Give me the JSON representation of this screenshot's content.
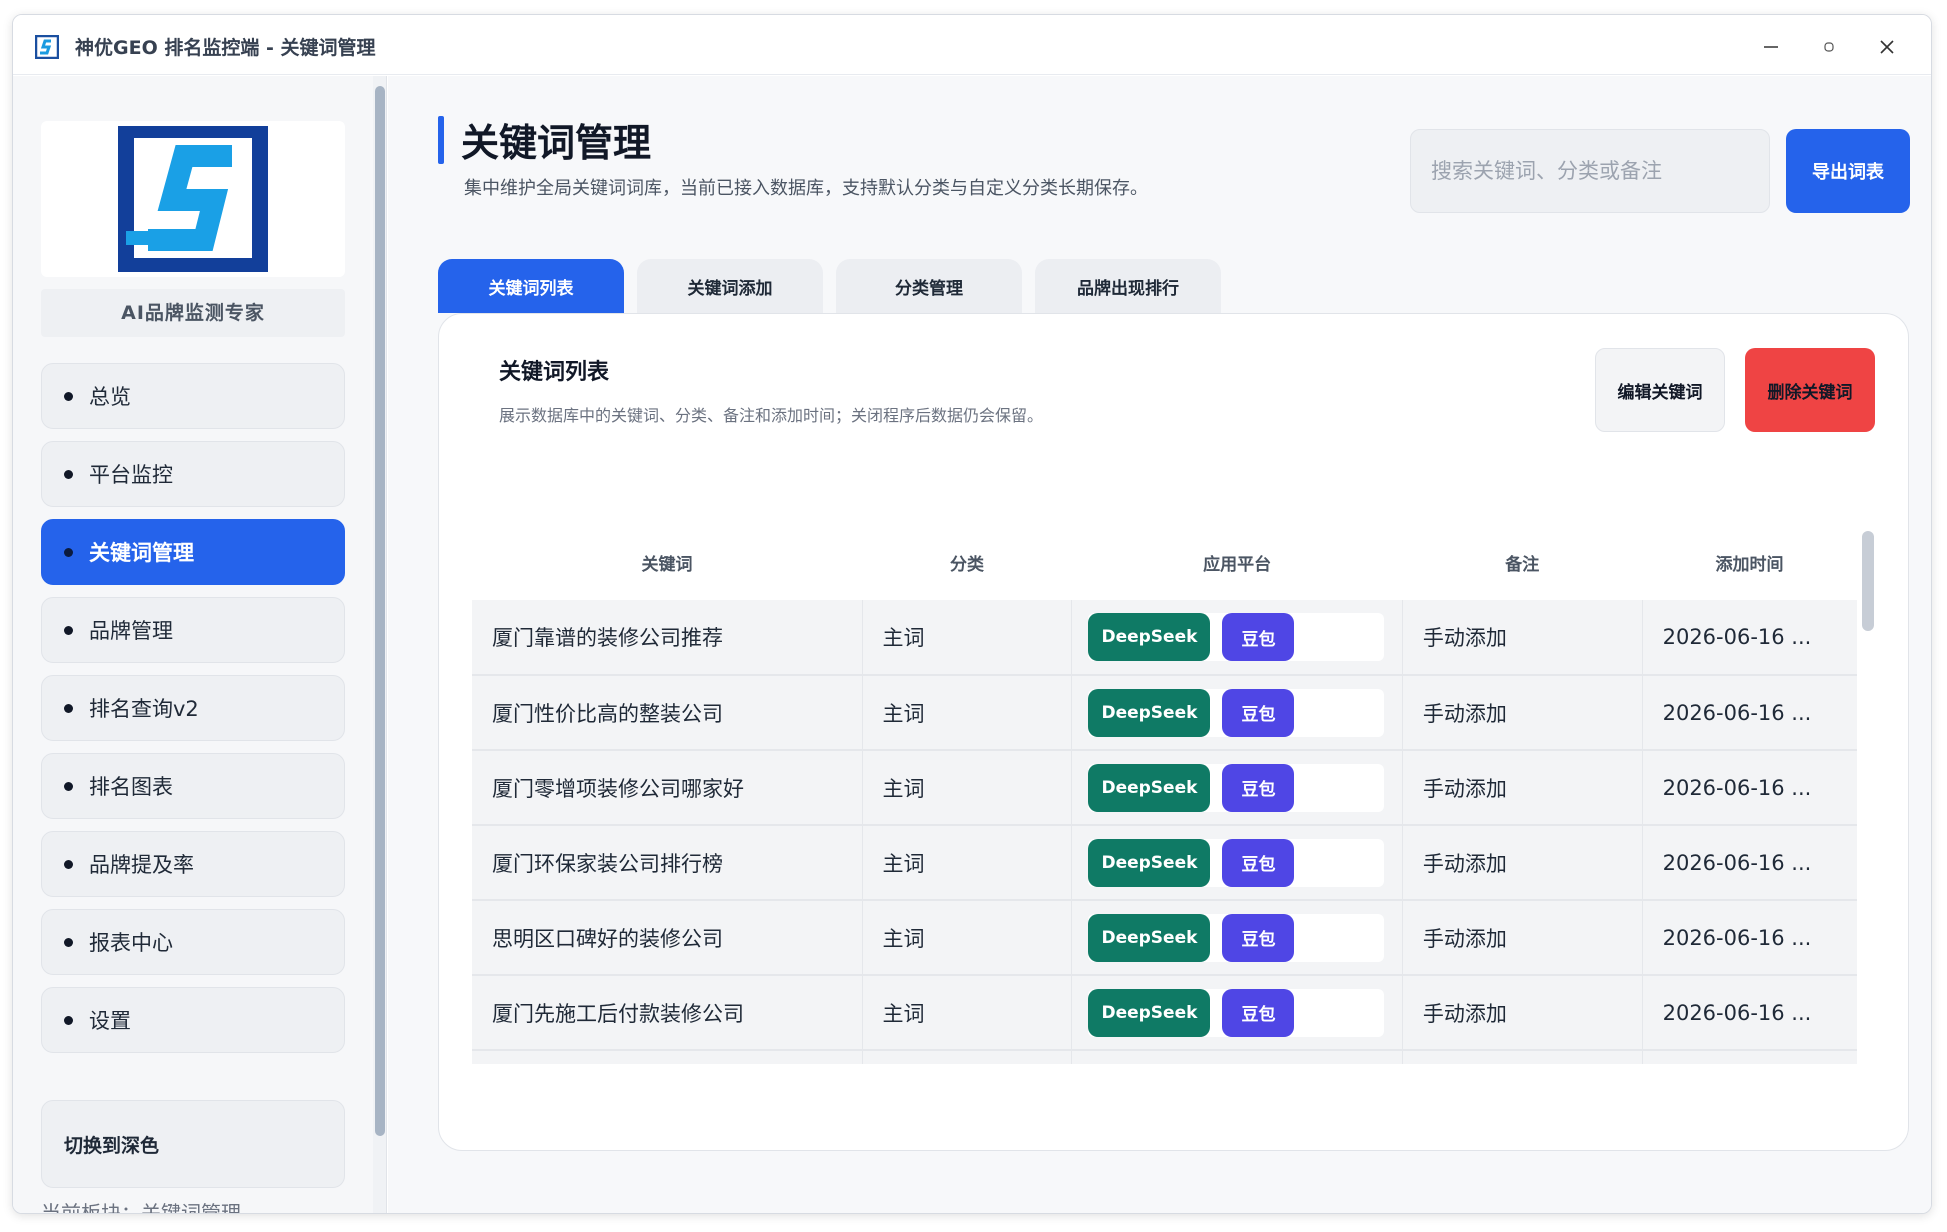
{
  "window": {
    "title": "神优GEO 排名监控端 - 关键词管理"
  },
  "sidebar": {
    "brand_caption": "AI品牌监测专家",
    "items": [
      {
        "label": "总览",
        "active": false
      },
      {
        "label": "平台监控",
        "active": false
      },
      {
        "label": "关键词管理",
        "active": true
      },
      {
        "label": "品牌管理",
        "active": false
      },
      {
        "label": "排名查询v2",
        "active": false
      },
      {
        "label": "排名图表",
        "active": false
      },
      {
        "label": "品牌提及率",
        "active": false
      },
      {
        "label": "报表中心",
        "active": false
      },
      {
        "label": "设置",
        "active": false
      }
    ],
    "theme_button": "切换到深色",
    "status": "当前板块：关键词管理"
  },
  "header": {
    "title": "关键词管理",
    "subtitle": "集中维护全局关键词词库，当前已接入数据库，支持默认分类与自定义分类长期保存。",
    "search_placeholder": "搜索关键词、分类或备注",
    "export_label": "导出词表"
  },
  "tabs": [
    {
      "label": "关键词列表",
      "active": true
    },
    {
      "label": "关键词添加",
      "active": false
    },
    {
      "label": "分类管理",
      "active": false
    },
    {
      "label": "品牌出现排行",
      "active": false
    }
  ],
  "panel": {
    "title": "关键词列表",
    "subtitle": "展示数据库中的关键词、分类、备注和添加时间；关闭程序后数据仍会保留。",
    "edit_label": "编辑关键词",
    "delete_label": "删除关键词"
  },
  "table": {
    "columns": [
      "关键词",
      "分类",
      "应用平台",
      "备注",
      "添加时间"
    ],
    "platform_labels": [
      "DeepSeek",
      "豆包"
    ],
    "rows": [
      {
        "keyword": "厦门靠谱的装修公司推荐",
        "category": "主词",
        "note": "手动添加",
        "time": "2026-06-16 ..."
      },
      {
        "keyword": "厦门性价比高的整装公司",
        "category": "主词",
        "note": "手动添加",
        "time": "2026-06-16 ..."
      },
      {
        "keyword": "厦门零增项装修公司哪家好",
        "category": "主词",
        "note": "手动添加",
        "time": "2026-06-16 ..."
      },
      {
        "keyword": "厦门环保家装公司排行榜",
        "category": "主词",
        "note": "手动添加",
        "time": "2026-06-16 ..."
      },
      {
        "keyword": "思明区口碑好的装修公司",
        "category": "主词",
        "note": "手动添加",
        "time": "2026-06-16 ..."
      },
      {
        "keyword": "厦门先施工后付款装修公司",
        "category": "主词",
        "note": "手动添加",
        "time": "2026-06-16 ..."
      },
      {
        "keyword": "",
        "category": "",
        "note": "",
        "time": ""
      }
    ]
  },
  "colors": {
    "accent": "#2563eb",
    "danger": "#ef4444",
    "deepseek": "#0f7a65",
    "doubao": "#4f46e5"
  },
  "icons": {
    "app": "app-logo-icon",
    "minimize": "minimize-icon",
    "maximize": "maximize-icon",
    "close": "close-icon"
  }
}
